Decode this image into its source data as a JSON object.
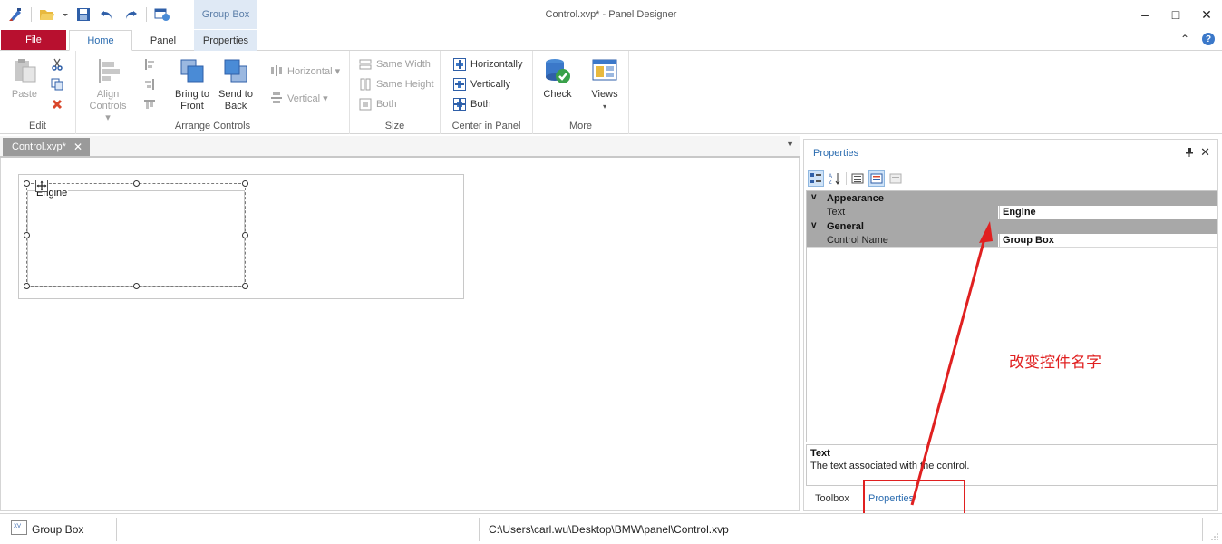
{
  "window": {
    "title": "Control.xvp* - Panel Designer",
    "context_tab_group": "Group Box",
    "minimize": "–",
    "maximize": "□",
    "close": "✕"
  },
  "ribbon_tabs": {
    "file": "File",
    "home": "Home",
    "panel": "Panel",
    "properties": "Properties",
    "collapse": "⌃",
    "help": "?"
  },
  "ribbon": {
    "edit": {
      "label": "Edit",
      "paste": "Paste"
    },
    "arrange": {
      "label": "Arrange Controls",
      "align_line1": "Align",
      "align_line2": "Controls ▾",
      "bring_line1": "Bring to",
      "bring_line2": "Front",
      "send_line1": "Send to",
      "send_line2": "Back",
      "horizontal": "Horizontal ▾",
      "vertical": "Vertical ▾"
    },
    "size": {
      "label": "Size",
      "same_width": "Same Width",
      "same_height": "Same Height",
      "both": "Both"
    },
    "center": {
      "label": "Center in Panel",
      "horizontally": "Horizontally",
      "vertically": "Vertically",
      "both": "Both"
    },
    "more": {
      "label": "More",
      "check": "Check",
      "views": "Views",
      "views_arrow": "▾"
    }
  },
  "document": {
    "tab_label": "Control.xvp*",
    "tab_close": "✕",
    "dropdown": "▼",
    "groupbox_caption": "Engine"
  },
  "properties_panel": {
    "title": "Properties",
    "pin": "📌",
    "close": "✕",
    "categories": [
      {
        "name": "Appearance",
        "chevron": "v"
      },
      {
        "name": "General",
        "chevron": "v"
      }
    ],
    "rows": [
      {
        "name": "Text",
        "value": "Engine"
      },
      {
        "name": "Control Name",
        "value": "Group Box"
      }
    ],
    "description_title": "Text",
    "description_text": "The text associated with the control.",
    "bottom_tabs": [
      "Toolbox",
      "Properties"
    ]
  },
  "annotation": {
    "text": "改变控件名字",
    "color": "#e02020"
  },
  "statusbar": {
    "icon_label": "XV",
    "left": "Group Box",
    "path": "C:\\Users\\carl.wu\\Desktop\\BMW\\panel\\Control.xvp"
  },
  "colors": {
    "file_tab": "#b8102f",
    "accent": "#2b6cb0",
    "context_tab": "#dfe9f5",
    "category_row": "#a8a8a8"
  }
}
